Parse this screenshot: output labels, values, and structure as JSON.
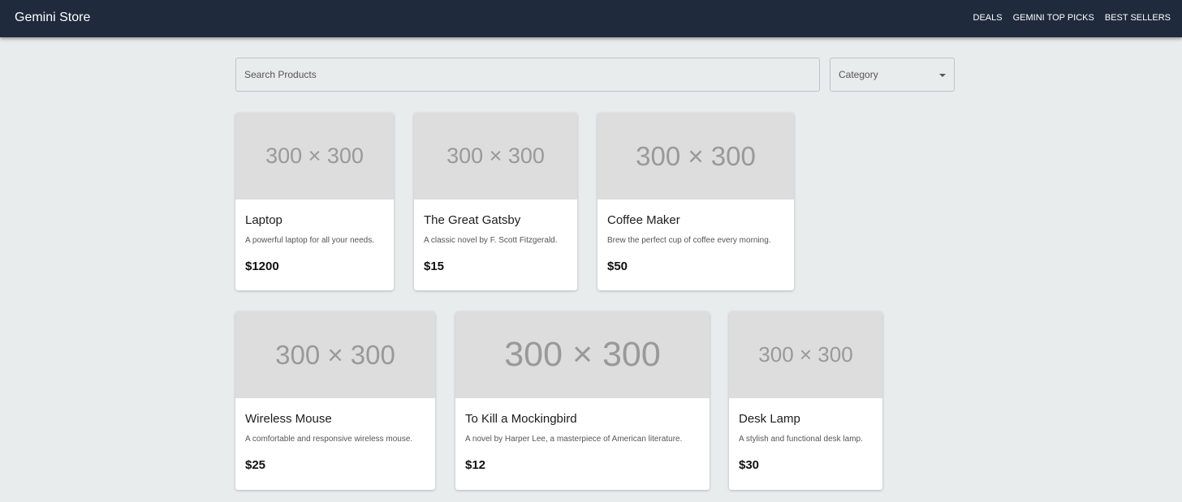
{
  "header": {
    "brand": "Gemini Store",
    "nav": [
      "DEALS",
      "GEMINI TOP PICKS",
      "BEST SELLERS"
    ]
  },
  "search": {
    "placeholder": "Search Products",
    "value": ""
  },
  "category": {
    "label": "Category"
  },
  "products": [
    {
      "image_text": "300 × 300",
      "title": "Laptop",
      "description": "A powerful laptop for all your needs.",
      "price": "$1200"
    },
    {
      "image_text": "300 × 300",
      "title": "The Great Gatsby",
      "description": "A classic novel by F. Scott Fitzgerald.",
      "price": "$15"
    },
    {
      "image_text": "300 × 300",
      "title": "Coffee Maker",
      "description": "Brew the perfect cup of coffee every morning.",
      "price": "$50"
    },
    {
      "image_text": "300 × 300",
      "title": "Wireless Mouse",
      "description": "A comfortable and responsive wireless mouse.",
      "price": "$25"
    },
    {
      "image_text": "300 × 300",
      "title": "To Kill a Mockingbird",
      "description": "A novel by Harper Lee, a masterpiece of American literature.",
      "price": "$12"
    },
    {
      "image_text": "300 × 300",
      "title": "Desk Lamp",
      "description": "A stylish and functional desk lamp.",
      "price": "$30"
    }
  ]
}
